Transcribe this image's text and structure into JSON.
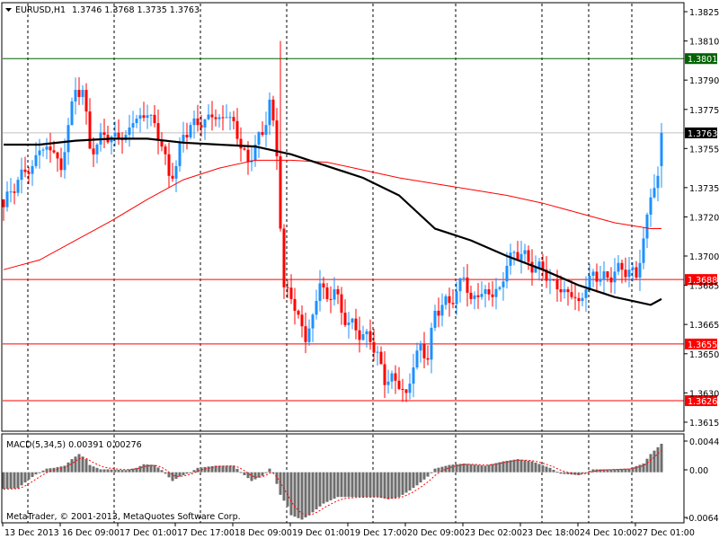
{
  "header": {
    "symbol": "EURUSD,H1",
    "ohlc": "1.3746 1.3768 1.3735 1.3763"
  },
  "indicator": {
    "label": "MACD(5,34,5) 0.00391 0.00276"
  },
  "copyright": "MetaTrader, © 2001-2013, MetaQuotes Software Corp.",
  "colors": {
    "bull": "#1E90FF",
    "bear": "#FF0000",
    "ma_fast": "#000000",
    "ma_slow": "#FF0000",
    "hist": "#6E6E6E",
    "signal": "#FF0000",
    "level_green": "#006400",
    "level_red": "#FF0000",
    "level_gray": "#C0C0C0"
  },
  "chart_data": [
    {
      "type": "candlestick",
      "title": "EURUSD,H1",
      "timeframe": "H1",
      "ylim": [
        1.361,
        1.383
      ],
      "y_ticks": [
        "1.3825",
        "1.3810",
        "1.3790",
        "1.3775",
        "1.3755",
        "1.3735",
        "1.3720",
        "1.3700",
        "1.3685",
        "1.3665",
        "1.3650",
        "1.3630",
        "1.3615"
      ],
      "x_ticks": [
        "13 Dec 2013",
        "16 Dec 09:00",
        "17 Dec 01:00",
        "17 Dec 17:00",
        "18 Dec 09:00",
        "19 Dec 01:00",
        "19 Dec 17:00",
        "20 Dec 09:00",
        "23 Dec 02:00",
        "23 Dec 18:00",
        "24 Dec 10:00",
        "27 Dec 01:00"
      ],
      "bar_count": 184,
      "closes_every_2_bars": [
        1.3725,
        1.3733,
        1.3739,
        1.3743,
        1.3746,
        1.3754,
        1.3756,
        1.3753,
        1.3744,
        1.3767,
        1.3785,
        1.3785,
        1.3755,
        1.3757,
        1.3762,
        1.3761,
        1.376,
        1.3762,
        1.3768,
        1.3772,
        1.3772,
        1.3768,
        1.3756,
        1.3741,
        1.3746,
        1.3762,
        1.3767,
        1.3767,
        1.377,
        1.3771,
        1.3771,
        1.3771,
        1.3769,
        1.3755,
        1.3748,
        1.3757,
        1.3762,
        1.378,
        1.3751,
        1.3684,
        1.3678,
        1.367,
        1.3656,
        1.367,
        1.3686,
        1.3678,
        1.3683,
        1.3671,
        1.3666,
        1.3662,
        1.366,
        1.3656,
        1.3651,
        1.3634,
        1.364,
        1.3632,
        1.363,
        1.3643,
        1.3655,
        1.3647,
        1.3672,
        1.3675,
        1.3676,
        1.3682,
        1.3689,
        1.3678,
        1.3679,
        1.3683,
        1.3679,
        1.3684,
        1.3695,
        1.3702,
        1.3701,
        1.3697,
        1.3694,
        1.3693,
        1.3688,
        1.3683,
        1.3683,
        1.3679,
        1.3677,
        1.3683,
        1.3692,
        1.3688,
        1.3689,
        1.3692,
        1.3693,
        1.3693,
        1.3689,
        1.3709,
        1.373,
        1.3741,
        1.3763
      ],
      "last": {
        "open": 1.3746,
        "high": 1.3768,
        "low": 1.3735,
        "close": 1.3763
      },
      "ma_fast_every_10_bars": [
        1.3757,
        1.3757,
        1.3759,
        1.376,
        1.376,
        1.3758,
        1.3757,
        1.3756,
        1.3752,
        1.3746,
        1.374,
        1.3731,
        1.3714,
        1.3708,
        1.37,
        1.3693,
        1.3685,
        1.3679,
        1.3675,
        1.3678
      ],
      "ma_slow_every_10_bars": [
        1.3693,
        1.3698,
        1.3708,
        1.3718,
        1.3729,
        1.3739,
        1.3745,
        1.3749,
        1.3749,
        1.3748,
        1.3744,
        1.374,
        1.3737,
        1.3734,
        1.3731,
        1.3727,
        1.3722,
        1.3717,
        1.3714,
        1.3714
      ],
      "levels": [
        {
          "value": "1.3801",
          "color": "green"
        },
        {
          "value": "1.3763",
          "color": "black",
          "line": "gray"
        },
        {
          "value": "1.3688",
          "color": "red"
        },
        {
          "value": "1.3655",
          "color": "red"
        },
        {
          "value": "1.3626",
          "color": "red"
        }
      ]
    },
    {
      "type": "bar",
      "title": "MACD(5,34,5)",
      "ylim": [
        -0.00645,
        0.0044
      ],
      "y_ticks": [
        "0.0044",
        "0.00",
        "-0.00645"
      ],
      "macd_value": 0.00391,
      "signal_value": 0.00276,
      "histogram_points": [
        [
          0,
          -0.0023
        ],
        [
          4,
          -0.0022
        ],
        [
          7,
          -0.001
        ],
        [
          9,
          -0.0003
        ],
        [
          12,
          0.0005
        ],
        [
          14,
          0.0006
        ],
        [
          17,
          0.0009
        ],
        [
          19,
          0.0018
        ],
        [
          21,
          0.0025
        ],
        [
          23,
          0.0018
        ],
        [
          24,
          0.001
        ],
        [
          27,
          0.0004
        ],
        [
          29,
          0.0004
        ],
        [
          34,
          0.0003
        ],
        [
          37,
          0.0006
        ],
        [
          39,
          0.0011
        ],
        [
          42,
          0.001
        ],
        [
          44,
          0.0003
        ],
        [
          47,
          -0.0012
        ],
        [
          49,
          -0.0006
        ],
        [
          52,
          0
        ],
        [
          54,
          0.0006
        ],
        [
          59,
          0.0009
        ],
        [
          64,
          0.0009
        ],
        [
          67,
          -0.0004
        ],
        [
          69,
          -0.0012
        ],
        [
          72,
          -0.0005
        ],
        [
          74,
          0.0005
        ],
        [
          75,
          -0.0001
        ],
        [
          77,
          -0.0031
        ],
        [
          79,
          -0.0047
        ],
        [
          80,
          -0.0059
        ],
        [
          83,
          -0.0065
        ],
        [
          85,
          -0.0059
        ],
        [
          89,
          -0.0043
        ],
        [
          93,
          -0.0034
        ],
        [
          104,
          -0.0034
        ],
        [
          107,
          -0.0037
        ],
        [
          110,
          -0.0034
        ],
        [
          113,
          -0.0025
        ],
        [
          115,
          -0.0018
        ],
        [
          118,
          -0.0006
        ],
        [
          120,
          0.0005
        ],
        [
          124,
          0.001
        ],
        [
          128,
          0.0012
        ],
        [
          134,
          0.0009
        ],
        [
          139,
          0.0015
        ],
        [
          143,
          0.0018
        ],
        [
          147,
          0.0015
        ],
        [
          152,
          0.0006
        ],
        [
          155,
          -0.0002
        ],
        [
          160,
          -0.0004
        ],
        [
          164,
          0.0004
        ],
        [
          169,
          0.0004
        ],
        [
          174,
          0.0005
        ],
        [
          178,
          0.0012
        ],
        [
          180,
          0.0025
        ],
        [
          183,
          0.0039
        ]
      ]
    }
  ]
}
